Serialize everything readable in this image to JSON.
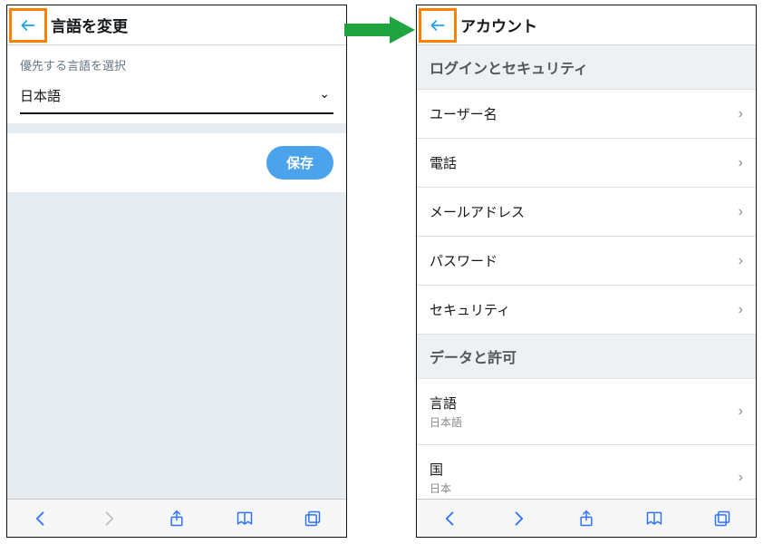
{
  "left": {
    "title": "言語を変更",
    "lang_label": "優先する言語を選択",
    "lang_value": "日本語",
    "save_label": "保存"
  },
  "right": {
    "title": "アカウント",
    "sections": {
      "login": {
        "header": "ログインとセキュリティ",
        "items": [
          "ユーザー名",
          "電話",
          "メールアドレス",
          "パスワード",
          "セキュリティ"
        ]
      },
      "data": {
        "header": "データと許可",
        "items": [
          {
            "label": "言語",
            "sub": "日本語"
          },
          {
            "label": "国",
            "sub": "日本"
          }
        ]
      }
    }
  }
}
